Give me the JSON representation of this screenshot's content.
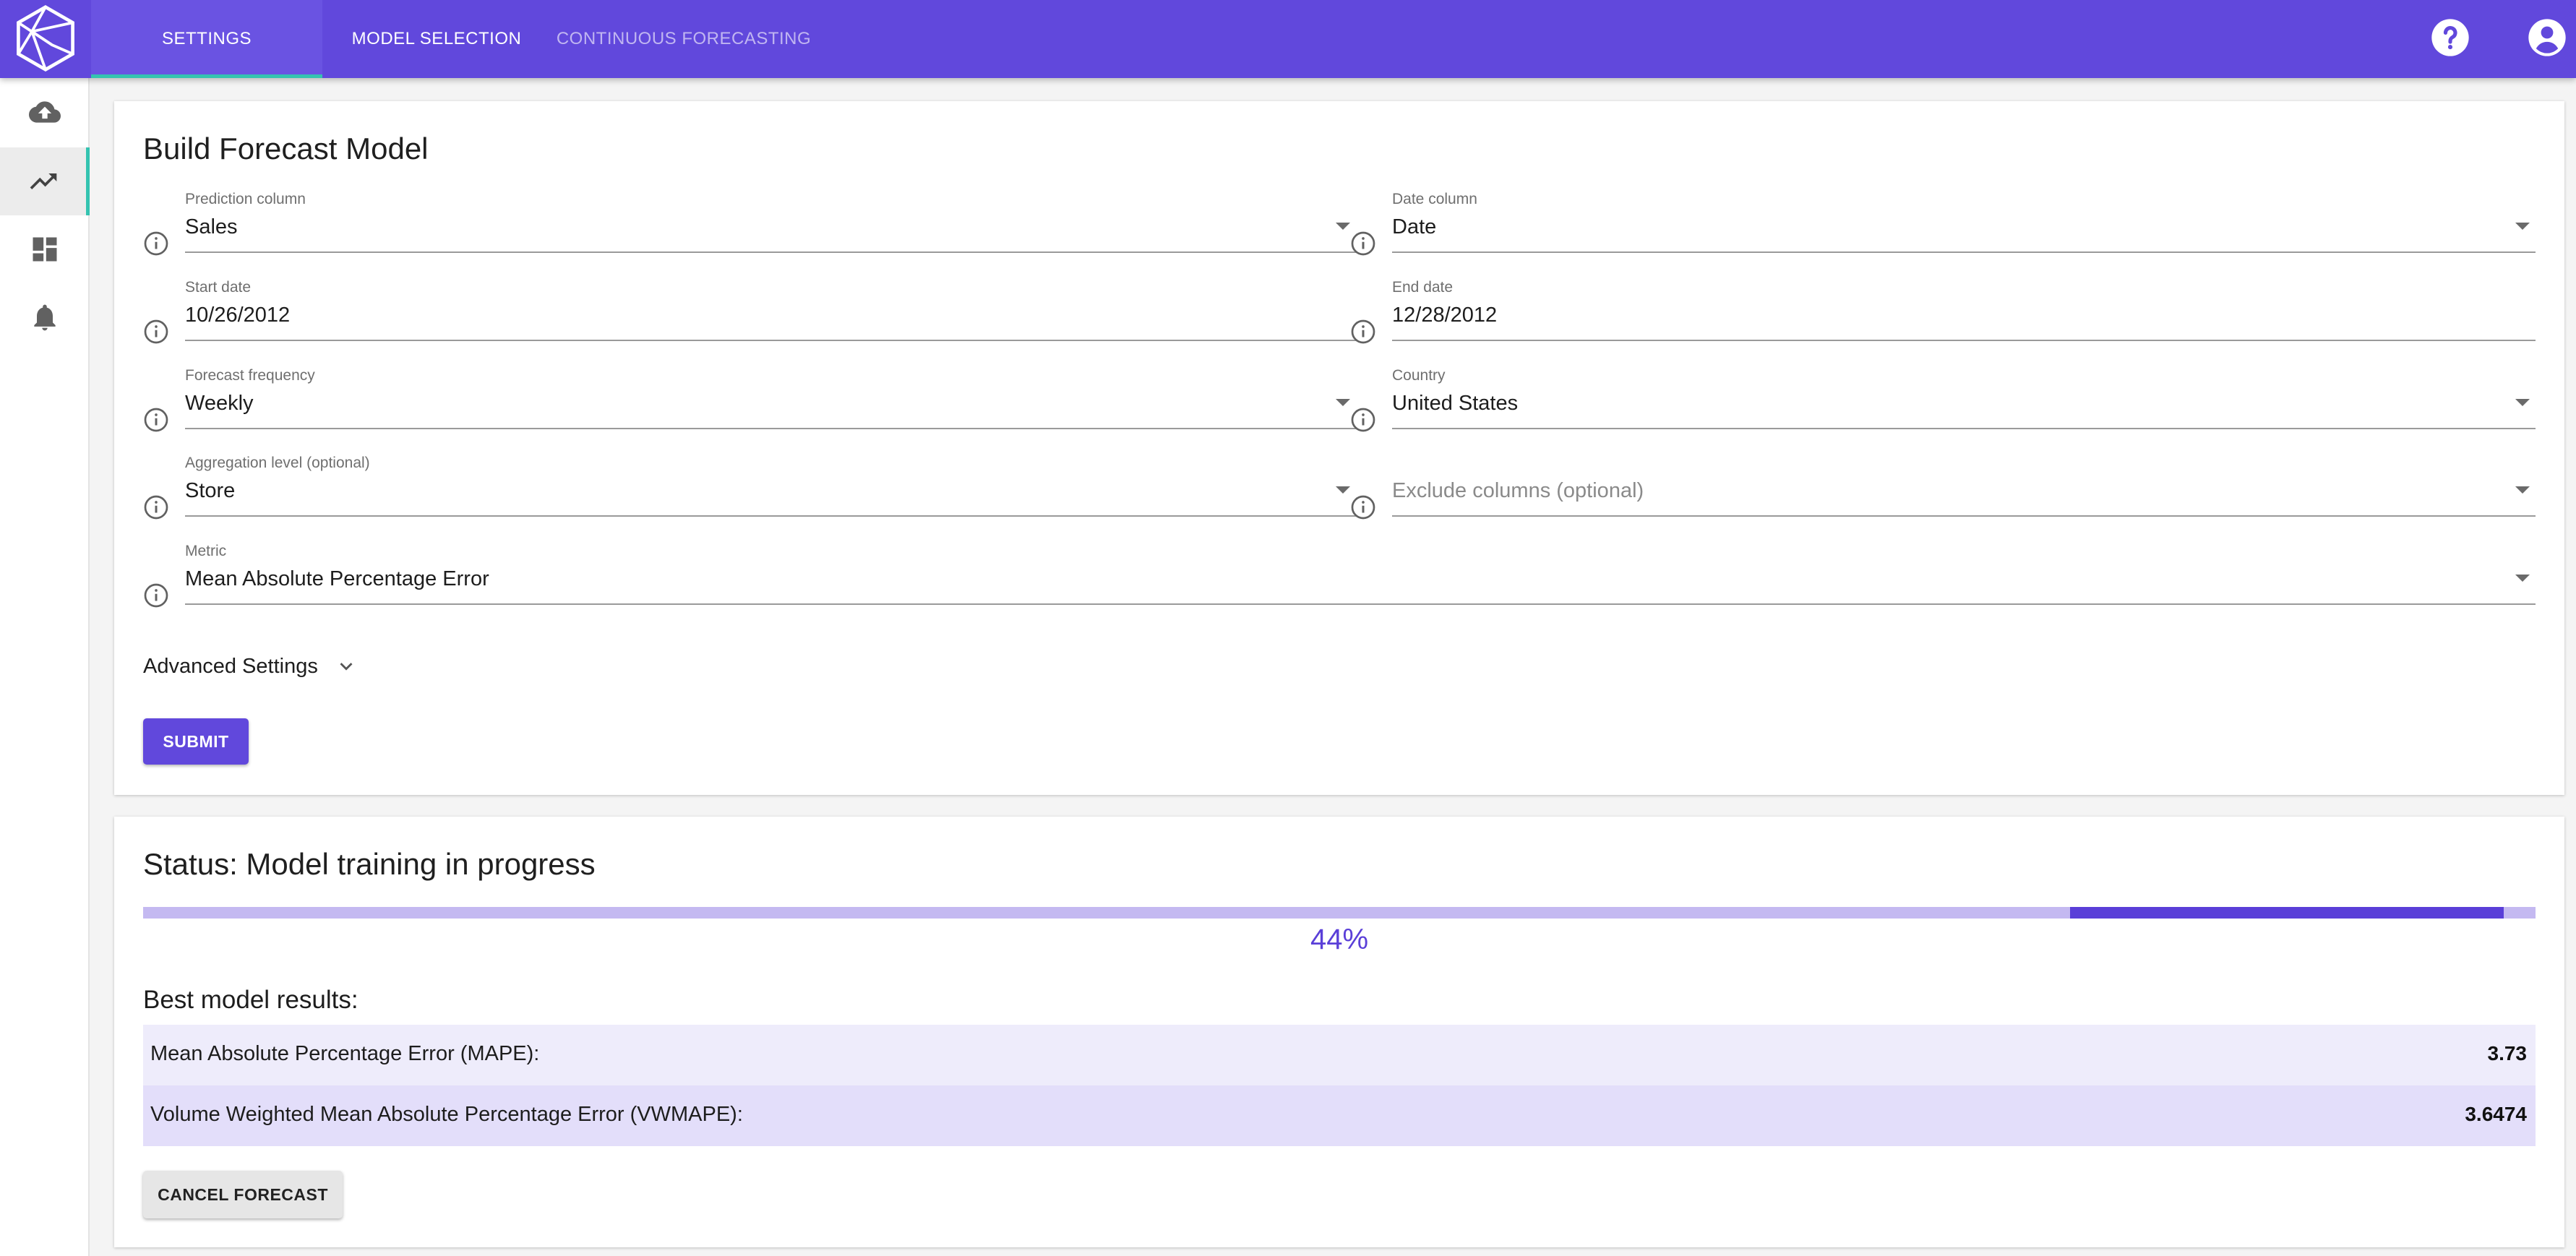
{
  "topbar": {
    "tabs": [
      {
        "label": "SETTINGS"
      },
      {
        "label": "MODEL SELECTION"
      },
      {
        "label": "CONTINUOUS FORECASTING"
      }
    ],
    "active_tab": "SETTINGS",
    "brand_color": "#6148dc",
    "accent_color": "#34c3b0",
    "icons": [
      "help-icon",
      "account-icon"
    ]
  },
  "sidebar": {
    "items": [
      {
        "icon": "cloud-upload-icon"
      },
      {
        "icon": "trending-up-icon",
        "active": true
      },
      {
        "icon": "dashboard-icon"
      },
      {
        "icon": "bell-icon"
      }
    ]
  },
  "build": {
    "title": "Build Forecast Model",
    "fields": {
      "prediction": {
        "label": "Prediction column",
        "value": "Sales"
      },
      "date": {
        "label": "Date column",
        "value": "Date"
      },
      "start": {
        "label": "Start date",
        "value": "10/26/2012"
      },
      "end": {
        "label": "End date",
        "value": "12/28/2012"
      },
      "frequency": {
        "label": "Forecast frequency",
        "value": "Weekly"
      },
      "country": {
        "label": "Country",
        "value": "United States"
      },
      "aggregation": {
        "label": "Aggregation level (optional)",
        "value": "Store"
      },
      "exclude": {
        "placeholder": "Exclude columns (optional)"
      },
      "metric": {
        "label": "Metric",
        "value": "Mean Absolute Percentage Error"
      }
    },
    "advanced_label": "Advanced Settings",
    "submit_label": "SUBMIT"
  },
  "status": {
    "title": "Status: Model training in progress",
    "progress_percent_text": "44%",
    "best_heading": "Best model results:",
    "results": [
      {
        "label": "Mean Absolute Percentage Error (MAPE):",
        "value": "3.73",
        "bg": "#eeecfb"
      },
      {
        "label": "Volume Weighted Mean Absolute Percentage Error (VWMAPE):",
        "value": "3.6474",
        "bg": "#e3defa"
      }
    ],
    "cancel_label": "CANCEL FORECAST"
  }
}
